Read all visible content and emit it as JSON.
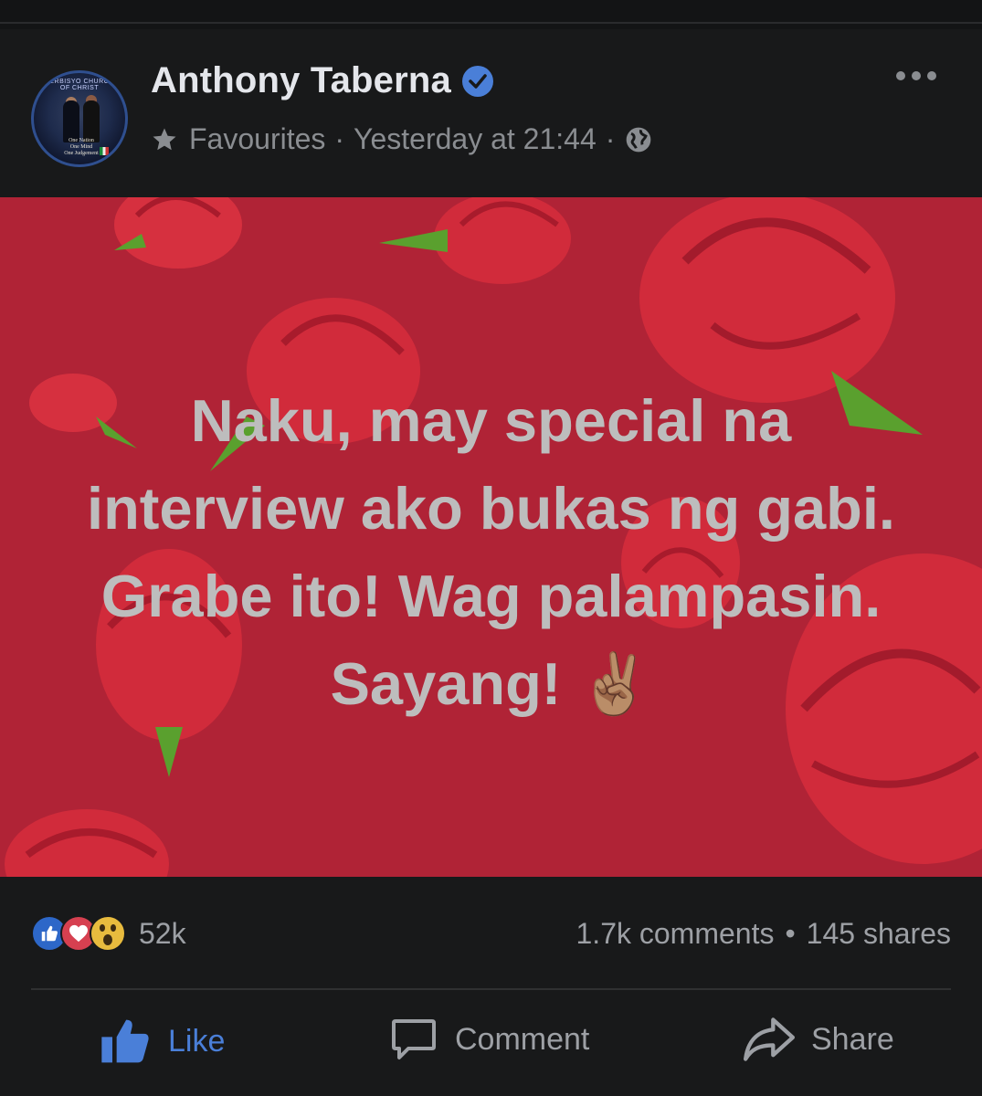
{
  "post": {
    "author": "Anthony Taberna",
    "audience": "Favourites",
    "timestamp": "Yesterday at 21:44",
    "separator": "·",
    "text": "Naku, may special na interview ako bukas ng gabi. Grabe ito! Wag palampasin. Sayang! ✌🏽",
    "avatar": {
      "ring_text": "SERBISYO CHURCH OF CHRIST",
      "motto_1": "One Nation",
      "motto_2": "One Mind",
      "motto_3": "One Judgement"
    }
  },
  "stats": {
    "reactions_count": "52k",
    "comments": "1.7k comments",
    "dot": "•",
    "shares": "145 shares"
  },
  "actions": {
    "like": "Like",
    "comment": "Comment",
    "share": "Share"
  },
  "colors": {
    "background": "#18191a",
    "accent": "#4a7fd8",
    "image_background": "#b02336"
  },
  "icons": [
    "verified-badge-icon",
    "star-icon",
    "globe-icon",
    "more-icon",
    "like-reaction-icon",
    "love-reaction-icon",
    "wow-reaction-icon",
    "thumbs-up-icon",
    "comment-icon",
    "share-icon"
  ]
}
